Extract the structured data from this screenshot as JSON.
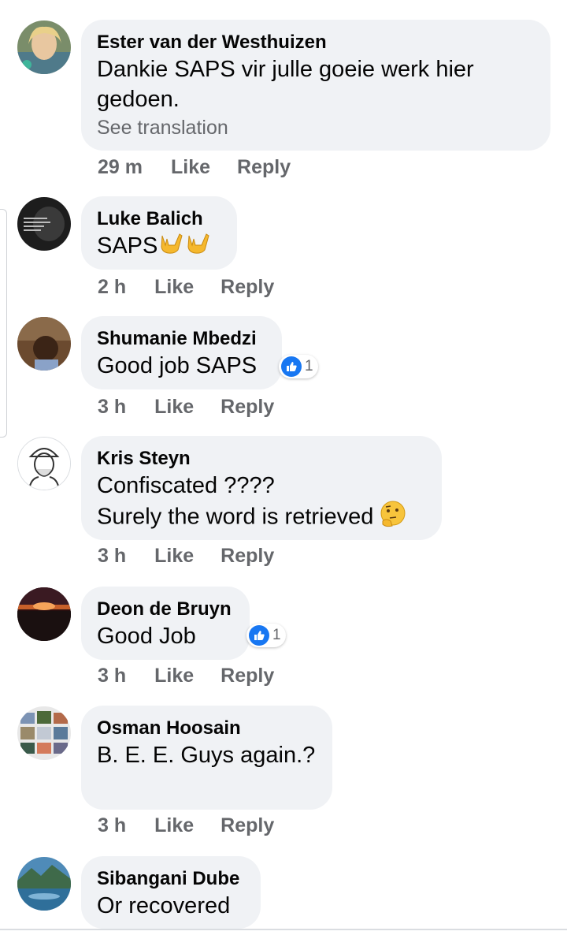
{
  "comments": [
    {
      "author": "Ester van der Westhuizen",
      "text_lines": [
        "Dankie SAPS vir julle goeie werk hier",
        "gedoen."
      ],
      "see_translation": "See translation",
      "time": "29 m",
      "like_label": "Like",
      "reply_label": "Reply"
    },
    {
      "author": "Luke Balich",
      "text_lines": [
        "SAPS"
      ],
      "emojis": [
        "sign-of-horns-icon",
        "sign-of-horns-icon"
      ],
      "time": "2 h",
      "like_label": "Like",
      "reply_label": "Reply"
    },
    {
      "author": "Shumanie Mbedzi",
      "text_lines": [
        "Good job SAPS"
      ],
      "reaction_count": "1",
      "time": "3 h",
      "like_label": "Like",
      "reply_label": "Reply"
    },
    {
      "author": "Kris Steyn",
      "text_lines": [
        "Confiscated ????",
        "Surely the word is retrieved"
      ],
      "emojis": [
        "thinking-face-icon"
      ],
      "time": "3 h",
      "like_label": "Like",
      "reply_label": "Reply"
    },
    {
      "author": "Deon de Bruyn",
      "text_lines": [
        "Good Job"
      ],
      "reaction_count": "1",
      "time": "3 h",
      "like_label": "Like",
      "reply_label": "Reply"
    },
    {
      "author": "Osman Hoosain",
      "text_lines": [
        "B. E. E. Guys again.?"
      ],
      "time": "3 h",
      "like_label": "Like",
      "reply_label": "Reply"
    },
    {
      "author": "Sibangani Dube",
      "text_lines": [
        "Or recovered"
      ]
    }
  ],
  "colors": {
    "bubble": "#f0f2f5",
    "secondary_text": "#65676b",
    "like_blue": "#1877f2"
  }
}
